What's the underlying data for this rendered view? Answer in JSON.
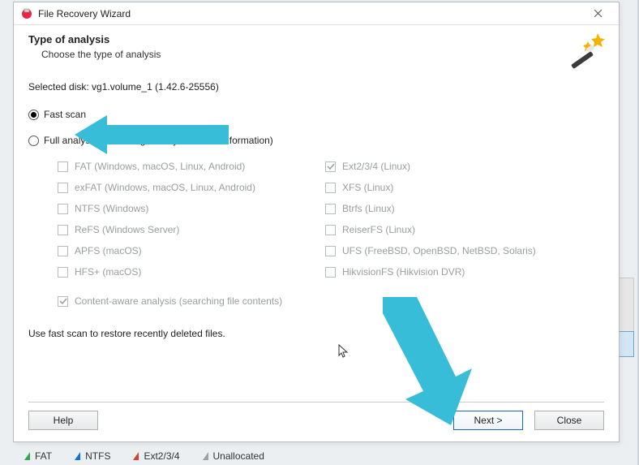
{
  "window": {
    "title": "File Recovery Wizard"
  },
  "header": {
    "title": "Type of analysis",
    "subtitle": "Choose the type of analysis"
  },
  "selected_disk_label": "Selected disk: vg1.volume_1 (1.42.6-25556)",
  "radios": {
    "fast_scan": "Fast scan",
    "full_analysis": "Full analysis (searching for any available information)"
  },
  "filesystems": {
    "left": [
      "FAT (Windows, macOS, Linux, Android)",
      "exFAT (Windows, macOS, Linux, Android)",
      "NTFS (Windows)",
      "ReFS (Windows Server)",
      "APFS (macOS)",
      "HFS+ (macOS)"
    ],
    "right": [
      "Ext2/3/4 (Linux)",
      "XFS (Linux)",
      "Btrfs (Linux)",
      "ReiserFS (Linux)",
      "UFS (FreeBSD, OpenBSD, NetBSD, Solaris)",
      "HikvisionFS (Hikvision DVR)"
    ]
  },
  "content_aware_label": "Content-aware analysis (searching file contents)",
  "hint": "Use fast scan to restore recently deleted files.",
  "buttons": {
    "help": "Help",
    "next": "Next >",
    "close": "Close"
  },
  "legend": {
    "fat": "FAT",
    "ntfs": "NTFS",
    "ext": "Ext2/3/4",
    "unalloc": "Unallocated"
  },
  "colors": {
    "arrow": "#38bdd9",
    "primary_border": "#1a66c2"
  }
}
